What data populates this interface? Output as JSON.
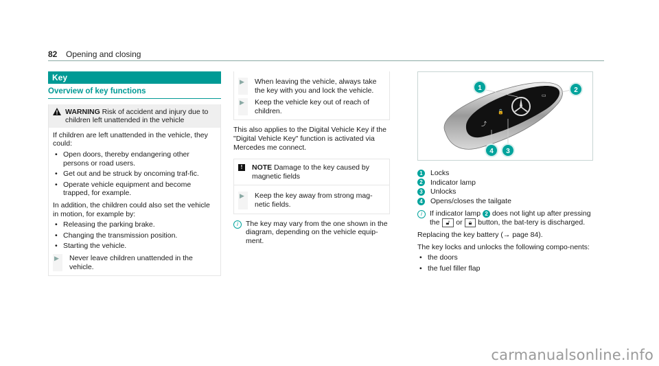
{
  "header": {
    "page_number": "82",
    "section_title": "Opening and closing"
  },
  "col1": {
    "section_heading": "Key",
    "subheading": "Overview of key functions",
    "warning": {
      "label": "WARNING",
      "title": "Risk of accident and injury due to children left unattended in the vehicle",
      "intro": "If children are left unattended in the vehicle, they could:",
      "bullets": [
        "Open doors, thereby endangering other persons or road users.",
        "Get out and be struck by oncoming traf-fic.",
        "Operate vehicle equipment and become trapped, for example."
      ],
      "addition": "In addition, the children could also set the vehicle in motion, for example by:",
      "bullets2": [
        "Releasing the parking brake.",
        "Changing the transmission position.",
        "Starting the vehicle."
      ],
      "actions": [
        "Never leave children unattended in the vehicle."
      ]
    }
  },
  "col2": {
    "actions": [
      "When leaving the vehicle, always take the key with you and lock the vehicle.",
      "Keep the vehicle key out of reach of children."
    ],
    "digital_key_text": "This also applies to the Digital Vehicle Key if the \"Digital Vehicle Key\" function is activated via Mercedes me connect.",
    "note": {
      "icon": "!",
      "label": "NOTE",
      "title": "Damage to the key caused by magnetic fields",
      "action": "Keep the key away from strong mag-netic fields."
    },
    "info_icon": "i",
    "info_text": "The key may vary from the one shown in the diagram, depending on the vehicle equip-ment."
  },
  "col3": {
    "figure_callouts": [
      "1",
      "2",
      "3",
      "4"
    ],
    "legend": [
      {
        "num": "1",
        "label": "Locks"
      },
      {
        "num": "2",
        "label": "Indicator lamp"
      },
      {
        "num": "3",
        "label": "Unlocks"
      },
      {
        "num": "4",
        "label": "Opens/closes the tailgate"
      }
    ],
    "info": {
      "icon": "i",
      "part1": "If indicator lamp",
      "ref": "2",
      "part2": "does not light up after pressing the",
      "btn1": "unlock-button-symbol",
      "or": "or",
      "btn2": "lock-button-symbol",
      "part3": "button, the bat-tery is discharged."
    },
    "battery_text": "Replacing the key battery (→ page 84).",
    "components_intro": "The key locks and unlocks the following compo-nents:",
    "components": [
      "the doors",
      "the fuel filler flap"
    ]
  },
  "watermark": "carmanualsonline.info",
  "colors": {
    "accent": "#009a95",
    "rule": "#8aa9a4"
  }
}
